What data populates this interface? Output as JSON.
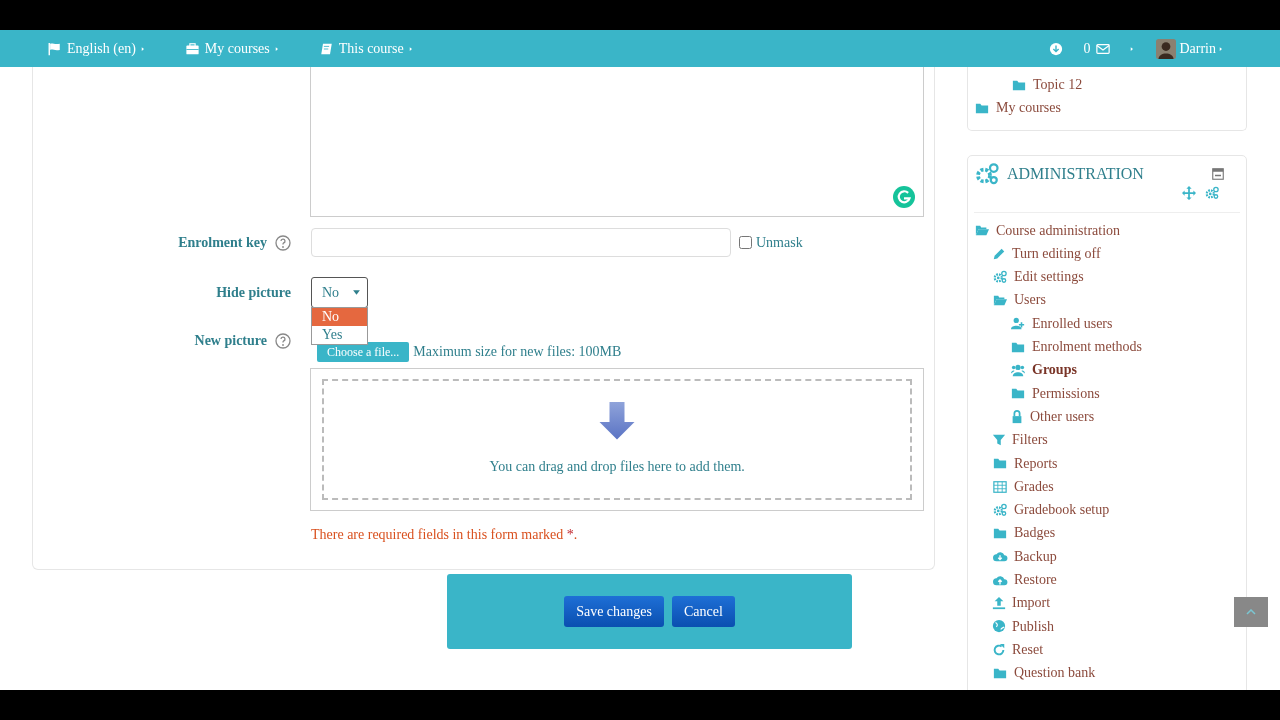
{
  "navbar": {
    "left": [
      {
        "kind": "flag",
        "label": "English (en)"
      },
      {
        "kind": "briefcase",
        "label": "My courses"
      },
      {
        "kind": "book",
        "label": "This course"
      }
    ],
    "messages_count": "0",
    "user": "Darrin"
  },
  "form": {
    "enrolment_key": {
      "label": "Enrolment key",
      "unmask_label": "Unmask",
      "unmask_checked": false
    },
    "hide_picture": {
      "label": "Hide picture",
      "value": "No",
      "open": true,
      "options": [
        {
          "label": "No",
          "selected": true
        },
        {
          "label": "Yes",
          "selected": false
        }
      ]
    },
    "new_picture": {
      "label": "New picture",
      "button": "Choose a file...",
      "max_size": "Maximum size for new files: 100MB",
      "drop_hint": "You can drag and drop files here to add them."
    },
    "required_note": {
      "text": "There are required fields in this form marked",
      "mark": "*",
      "end": "."
    },
    "buttons": [
      {
        "label": "Save changes"
      },
      {
        "label": "Cancel"
      }
    ]
  },
  "sidebar": {
    "navigation": {
      "partial_items": [
        {
          "kind": "folder",
          "label": "Topic 12",
          "expanded": false
        }
      ],
      "items": [
        {
          "kind": "folder",
          "label": "My courses",
          "expanded": false
        }
      ]
    },
    "administration": {
      "title": "ADMINISTRATION",
      "items": [
        {
          "kind": "folder",
          "label": "Course administration",
          "expanded": true,
          "current": false,
          "children": [
            {
              "kind": "pencil",
              "label": "Turn editing off",
              "current": false
            },
            {
              "kind": "gears",
              "label": "Edit settings",
              "current": false
            },
            {
              "kind": "folder",
              "label": "Users",
              "expanded": true,
              "current": false,
              "children": [
                {
                  "kind": "user-plus",
                  "label": "Enrolled users",
                  "current": false
                },
                {
                  "kind": "folder",
                  "label": "Enrolment methods",
                  "expanded": false,
                  "current": false
                },
                {
                  "kind": "users",
                  "label": "Groups",
                  "current": true
                },
                {
                  "kind": "folder",
                  "label": "Permissions",
                  "expanded": false,
                  "current": false
                },
                {
                  "kind": "lock",
                  "label": "Other users",
                  "current": false
                }
              ]
            },
            {
              "kind": "filter",
              "label": "Filters",
              "current": false
            },
            {
              "kind": "folder",
              "label": "Reports",
              "expanded": false,
              "current": false
            },
            {
              "kind": "table",
              "label": "Grades",
              "current": false
            },
            {
              "kind": "gears",
              "label": "Gradebook setup",
              "current": false
            },
            {
              "kind": "folder",
              "label": "Badges",
              "expanded": false,
              "current": false
            },
            {
              "kind": "cloud-down",
              "label": "Backup",
              "current": false
            },
            {
              "kind": "cloud-up",
              "label": "Restore",
              "current": false
            },
            {
              "kind": "upload",
              "label": "Import",
              "current": false
            },
            {
              "kind": "globe",
              "label": "Publish",
              "current": false
            },
            {
              "kind": "refresh",
              "label": "Reset",
              "current": false
            },
            {
              "kind": "folder",
              "label": "Question bank",
              "expanded": false,
              "current": false
            }
          ]
        }
      ]
    }
  }
}
